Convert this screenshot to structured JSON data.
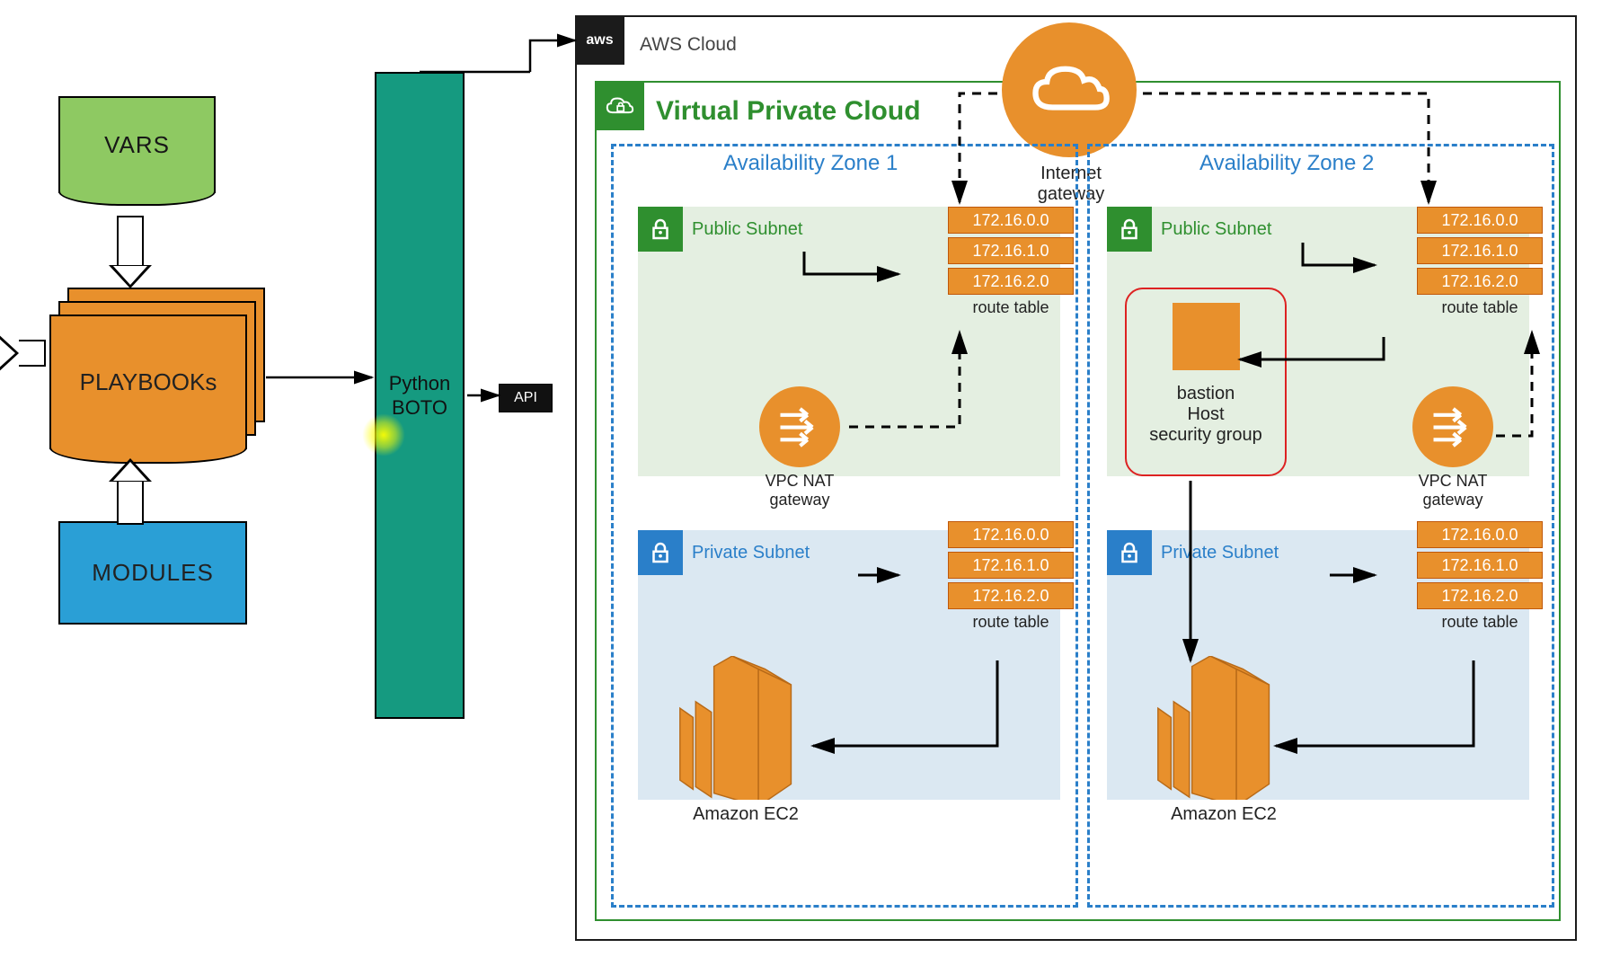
{
  "left": {
    "vars": "VARS",
    "playbooks": "PLAYBOOKs",
    "modules": "MODULES",
    "boto_line1": "Python",
    "boto_line2": "BOTO",
    "api": "API"
  },
  "cloud": {
    "aws_badge": "aws",
    "aws_label": "AWS Cloud",
    "vpc_title": "Virtual Private Cloud",
    "igw_line1": "Internet",
    "igw_line2": "gateway"
  },
  "az": {
    "one_title": "Availability Zone 1",
    "two_title": "Availability Zone 2",
    "public_subnet": "Public Subnet",
    "private_subnet": "Private Subnet",
    "route_table_label": "route table",
    "nat_line1": "VPC NAT",
    "nat_line2": "gateway",
    "ec2_label": "Amazon EC2",
    "bastion_line1": "bastion",
    "bastion_line2": "Host",
    "bastion_line3": "security group",
    "ips": {
      "ip0": "172.16.0.0",
      "ip1": "172.16.1.0",
      "ip2": "172.16.2.0"
    }
  }
}
